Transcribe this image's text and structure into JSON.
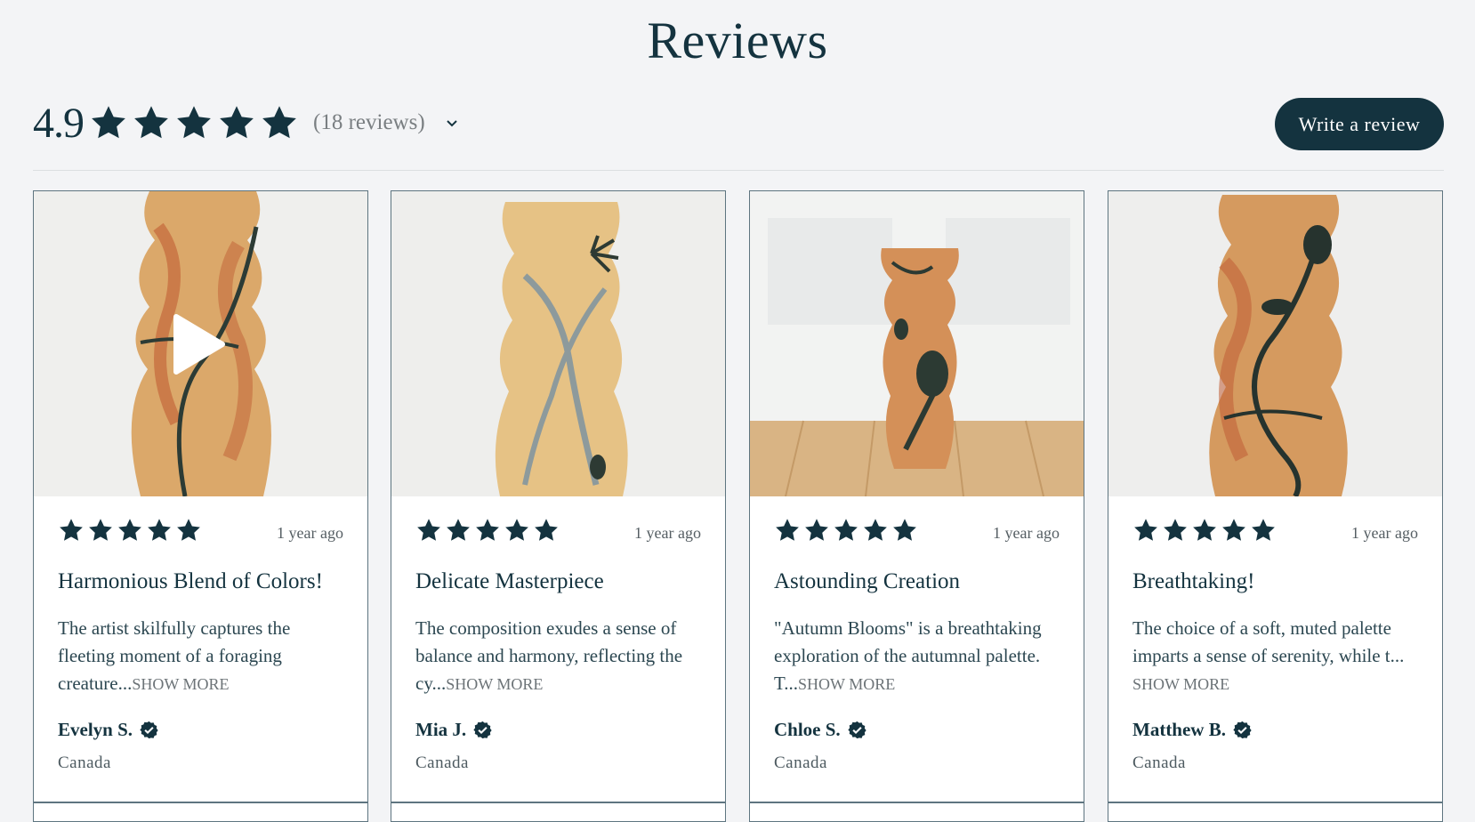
{
  "header": {
    "title": "Reviews"
  },
  "summary": {
    "average": "4.9",
    "stars": 5,
    "count_label": "(18 reviews)",
    "write_review_label": "Write a review"
  },
  "colors": {
    "accent": "#14333f",
    "background": "#f3f4f6",
    "card_border": "#5e7580"
  },
  "reviews": [
    {
      "rating": 5,
      "date": "1 year ago",
      "title": "Harmonious Blend of Colors!",
      "body": "The artist skilfully captures the fleeting moment of a foraging creature...",
      "show_more": "SHOW MORE",
      "author": "Evelyn S.",
      "country": "Canada",
      "has_video": true
    },
    {
      "rating": 5,
      "date": "1 year ago",
      "title": "Delicate Masterpiece",
      "body": "The composition exudes a sense of balance and harmony, reflecting the cy...",
      "show_more": "SHOW MORE",
      "author": "Mia J.",
      "country": "Canada",
      "has_video": false
    },
    {
      "rating": 5,
      "date": "1 year ago",
      "title": "Astounding Creation",
      "body": "\"Autumn Blooms\" is a breathtaking exploration of the autumnal palette. T...",
      "show_more": "SHOW MORE",
      "author": "Chloe S.",
      "country": "Canada",
      "has_video": false
    },
    {
      "rating": 5,
      "date": "1 year ago",
      "title": "Breathtaking!",
      "body": "The choice of a soft, muted palette imparts a sense of serenity, while t...",
      "show_more": "SHOW MORE",
      "author": "Matthew B.",
      "country": "Canada",
      "has_video": false
    }
  ],
  "icons": {
    "star": "star-icon",
    "chevron": "chevron-down-icon",
    "verified": "verified-badge-icon",
    "play": "play-icon"
  }
}
